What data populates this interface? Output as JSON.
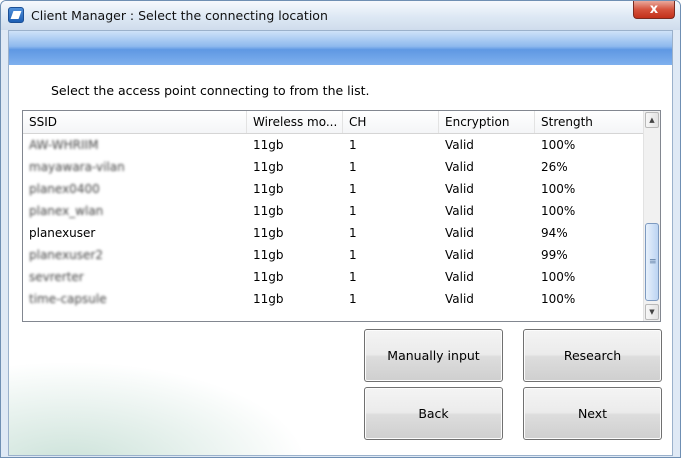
{
  "window": {
    "title": "Client Manager : Select the connecting location",
    "close_label": "x"
  },
  "instruction": "Select the access point connecting to from the list.",
  "list": {
    "columns": [
      "SSID",
      "Wireless mo...",
      "CH",
      "Encryption",
      "Strength"
    ],
    "rows": [
      {
        "ssid": "AW-WHRIIM",
        "mode": "11gb",
        "ch": "1",
        "encryption": "Valid",
        "strength": "100%",
        "blurred": true
      },
      {
        "ssid": "mayawara-vilan",
        "mode": "11gb",
        "ch": "1",
        "encryption": "Valid",
        "strength": "26%",
        "blurred": true
      },
      {
        "ssid": "planex0400",
        "mode": "11gb",
        "ch": "1",
        "encryption": "Valid",
        "strength": "100%",
        "blurred": true
      },
      {
        "ssid": "planex_wlan",
        "mode": "11gb",
        "ch": "1",
        "encryption": "Valid",
        "strength": "100%",
        "blurred": true
      },
      {
        "ssid": "planexuser",
        "mode": "11gb",
        "ch": "1",
        "encryption": "Valid",
        "strength": "94%",
        "blurred": false
      },
      {
        "ssid": "planexuser2",
        "mode": "11gb",
        "ch": "1",
        "encryption": "Valid",
        "strength": "99%",
        "blurred": true
      },
      {
        "ssid": "sevrerter",
        "mode": "11gb",
        "ch": "1",
        "encryption": "Valid",
        "strength": "100%",
        "blurred": true
      },
      {
        "ssid": "time-capsule",
        "mode": "11gb",
        "ch": "1",
        "encryption": "Valid",
        "strength": "100%",
        "blurred": true
      }
    ]
  },
  "buttons": {
    "manual": "Manually input",
    "research": "Research",
    "back": "Back",
    "next": "Next"
  },
  "colors": {
    "banner": "#6a9fe6",
    "close": "#c8432c",
    "frame": "#dfe9f5"
  }
}
